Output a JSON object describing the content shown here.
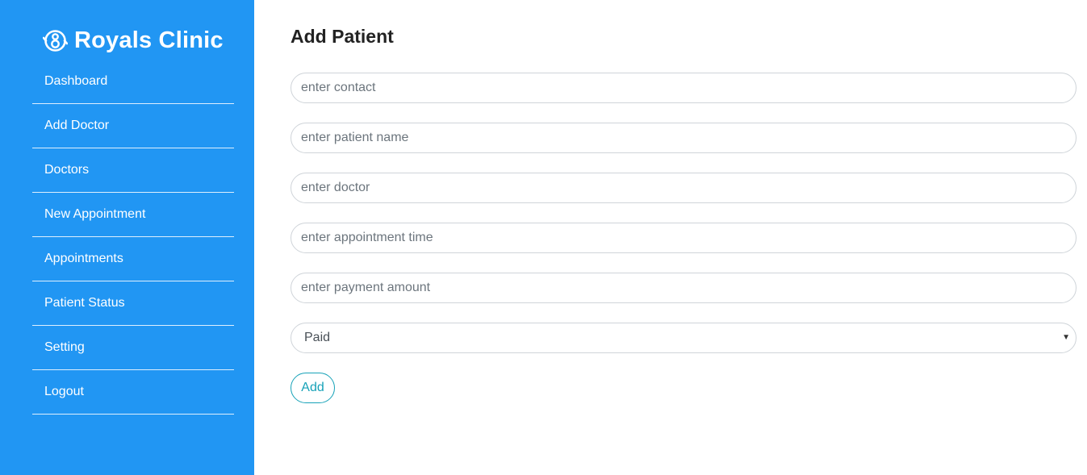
{
  "brand": {
    "title": "Royals Clinic",
    "icon": "clinic-logo-icon"
  },
  "sidebar": {
    "items": [
      {
        "label": "Dashboard"
      },
      {
        "label": "Add Doctor"
      },
      {
        "label": "Doctors"
      },
      {
        "label": "New Appointment"
      },
      {
        "label": "Appointments"
      },
      {
        "label": "Patient Status"
      },
      {
        "label": "Setting"
      },
      {
        "label": "Logout"
      }
    ]
  },
  "main": {
    "title": "Add Patient",
    "fields": {
      "contact": {
        "placeholder": "enter contact",
        "value": ""
      },
      "patient_name": {
        "placeholder": "enter patient name",
        "value": ""
      },
      "doctor": {
        "placeholder": "enter doctor",
        "value": ""
      },
      "appointment_time": {
        "placeholder": "enter appointment time",
        "value": ""
      },
      "payment_amount": {
        "placeholder": "enter payment amount",
        "value": ""
      }
    },
    "payment_status": {
      "selected": "Paid"
    },
    "add_label": "Add"
  },
  "colors": {
    "sidebar_bg": "#2196f3",
    "accent_button": "#17a2b8"
  }
}
